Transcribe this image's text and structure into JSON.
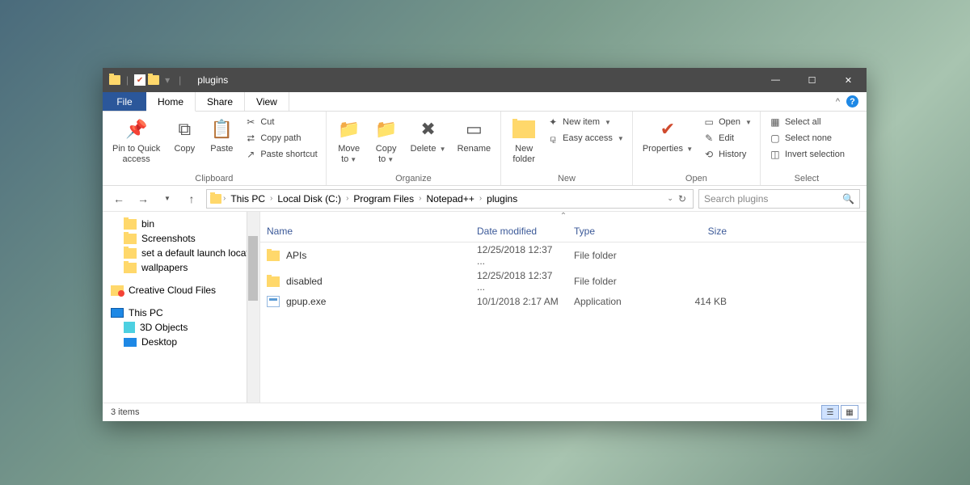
{
  "title": "plugins",
  "tabs": {
    "file": "File",
    "home": "Home",
    "share": "Share",
    "view": "View"
  },
  "ribbon": {
    "pin": "Pin to Quick\naccess",
    "copy": "Copy",
    "paste": "Paste",
    "cut": "Cut",
    "copypath": "Copy path",
    "pasteshortcut": "Paste shortcut",
    "clipboard": "Clipboard",
    "moveto": "Move\nto",
    "copyto": "Copy\nto",
    "delete": "Delete",
    "rename": "Rename",
    "organize": "Organize",
    "newfolder": "New\nfolder",
    "newitem": "New item",
    "easyaccess": "Easy access",
    "new": "New",
    "properties": "Properties",
    "open": "Open",
    "edit": "Edit",
    "history": "History",
    "openg": "Open",
    "selectall": "Select all",
    "selectnone": "Select none",
    "invertsel": "Invert selection",
    "select": "Select"
  },
  "breadcrumbs": [
    "This PC",
    "Local Disk (C:)",
    "Program Files",
    "Notepad++",
    "plugins"
  ],
  "search_placeholder": "Search plugins",
  "sidebar": [
    {
      "label": "bin",
      "icon": "folder",
      "level": 2
    },
    {
      "label": "Screenshots",
      "icon": "folder",
      "level": 2
    },
    {
      "label": "set a default launch location",
      "icon": "folder",
      "level": 2
    },
    {
      "label": "wallpapers",
      "icon": "folder",
      "level": 2
    },
    {
      "label": "Creative Cloud Files",
      "icon": "cc",
      "level": 1,
      "spacer": true
    },
    {
      "label": "This PC",
      "icon": "pc",
      "level": 1,
      "spacer": true
    },
    {
      "label": "3D Objects",
      "icon": "cube",
      "level": 2
    },
    {
      "label": "Desktop",
      "icon": "desk",
      "level": 2
    }
  ],
  "columns": {
    "name": "Name",
    "date": "Date modified",
    "type": "Type",
    "size": "Size"
  },
  "files": [
    {
      "name": "APIs",
      "date": "12/25/2018 12:37 ...",
      "type": "File folder",
      "size": "",
      "icon": "folder"
    },
    {
      "name": "disabled",
      "date": "12/25/2018 12:37 ...",
      "type": "File folder",
      "size": "",
      "icon": "folder"
    },
    {
      "name": "gpup.exe",
      "date": "10/1/2018 2:17 AM",
      "type": "Application",
      "size": "414 KB",
      "icon": "exe"
    }
  ],
  "status": "3 items"
}
